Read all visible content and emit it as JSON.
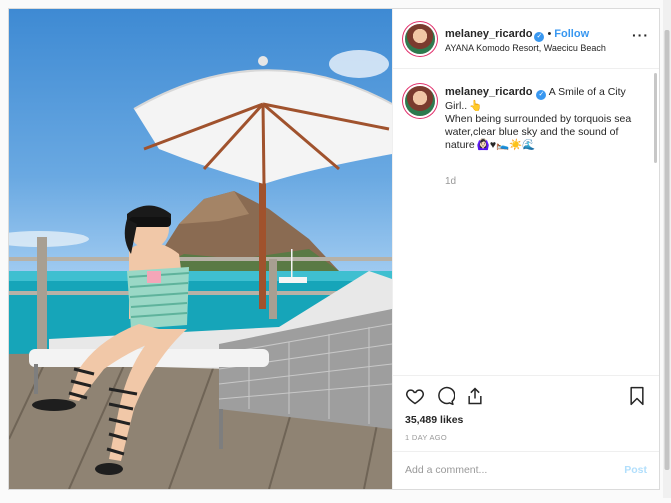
{
  "post": {
    "username": "melaney_ricardo",
    "follow_label": "Follow",
    "separator": "•",
    "location": "AYANA Komodo Resort, Waecicu Beach",
    "more_label": "···"
  },
  "caption": {
    "username": "melaney_ricardo",
    "text_line1": "A Smile of a City Girl..",
    "text_line2": "When being surrounded by torquois sea water,clear blue sky and the sound of nature",
    "emojis_a": "👆",
    "emojis_b": "🙆🏻‍♀️♥🛌☀️🌊",
    "timestamp": "1d"
  },
  "stats": {
    "likes": "35,489 likes",
    "posted_ago": "1 DAY AGO"
  },
  "comment_box": {
    "placeholder": "Add a comment...",
    "post_label": "Post"
  },
  "icons": [
    "heart-icon",
    "comment-icon",
    "share-icon",
    "bookmark-icon",
    "verified-badge-icon",
    "more-options-icon"
  ],
  "colors": {
    "accent": "#3897f0",
    "post_disabled": "#b2dffc",
    "muted": "#999999",
    "border": "#dbdbdb"
  }
}
